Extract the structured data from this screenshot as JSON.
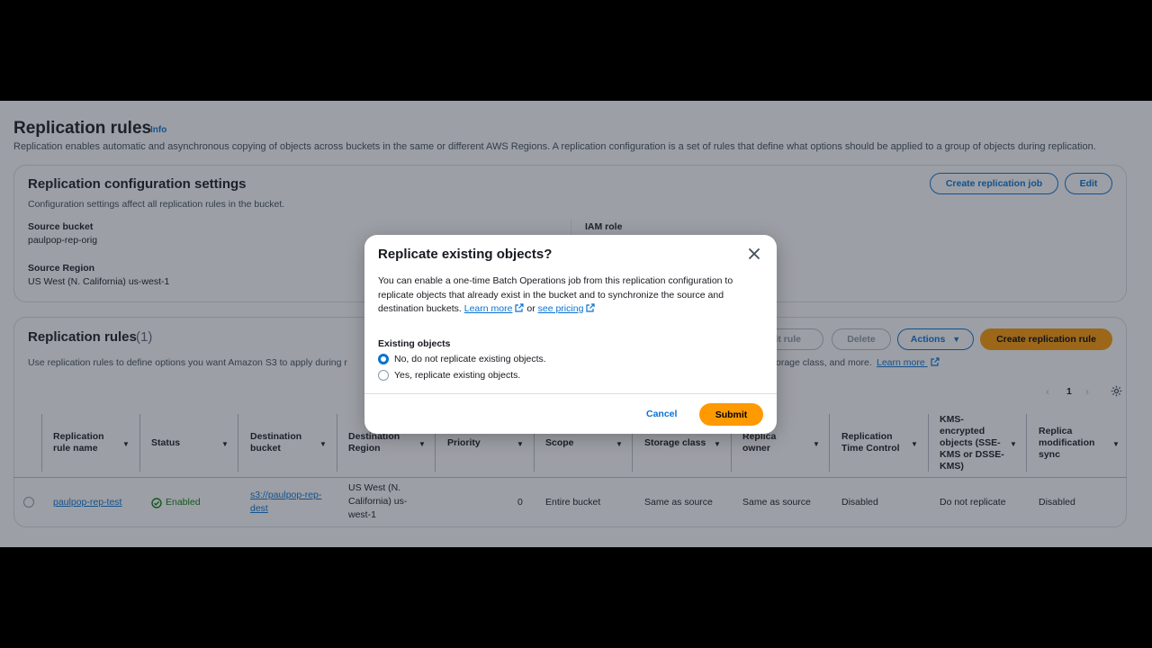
{
  "page": {
    "title": "Replication rules",
    "info": "Info",
    "description": "Replication enables automatic and asynchronous copying of objects across buckets in the same or different AWS Regions. A replication configuration is a set of rules that define what options should be applied to a group of objects during replication."
  },
  "config": {
    "title": "Replication configuration settings",
    "description": "Configuration settings affect all replication rules in the bucket.",
    "create_job_label": "Create replication job",
    "edit_label": "Edit",
    "source_bucket_key": "Source bucket",
    "source_bucket_value": "paulpop-rep-orig",
    "source_region_key": "Source Region",
    "source_region_value": "US West (N. California) us-west-1",
    "iam_role_key": "IAM role"
  },
  "rules": {
    "title": "Replication rules",
    "count": "(1)",
    "description": "Use replication rules to define options you want Amazon S3 to apply during r",
    "description_tail": "orage class, and more.",
    "learn_more": "Learn more",
    "edit_rule_label": "dit rule",
    "delete_label": "Delete",
    "actions_label": "Actions",
    "create_rule_label": "Create replication rule",
    "page_number": "1",
    "columns": [
      "Replication rule name",
      "Status",
      "Destination bucket",
      "Destination Region",
      "Priority",
      "Scope",
      "Storage class",
      "Replica owner",
      "Replication Time Control",
      "KMS-encrypted objects (SSE-KMS or DSSE-KMS)",
      "Replica modification sync"
    ],
    "row": {
      "name": "paulpop-rep-test",
      "status": "Enabled",
      "dest_bucket": "s3://paulpop-rep-dest",
      "dest_region": "US West (N. California) us-west-1",
      "priority": "0",
      "scope": "Entire bucket",
      "storage_class": "Same as source",
      "replica_owner": "Same as source",
      "rtc": "Disabled",
      "kms": "Do not replicate",
      "mod_sync": "Disabled"
    }
  },
  "modal": {
    "title": "Replicate existing objects?",
    "body": "You can enable a one-time Batch Operations job from this replication configuration to replicate objects that already exist in the bucket and to synchronize the source and destination buckets.",
    "learn_more": "Learn more",
    "or": "or",
    "see_pricing": "see pricing",
    "label": "Existing objects",
    "option_no": "No, do not replicate existing objects.",
    "option_yes": "Yes, replicate existing objects.",
    "selected": "no",
    "cancel": "Cancel",
    "submit": "Submit"
  },
  "colors": {
    "accent": "#0972d3",
    "primary": "#ff9900",
    "success": "#037f0c"
  }
}
